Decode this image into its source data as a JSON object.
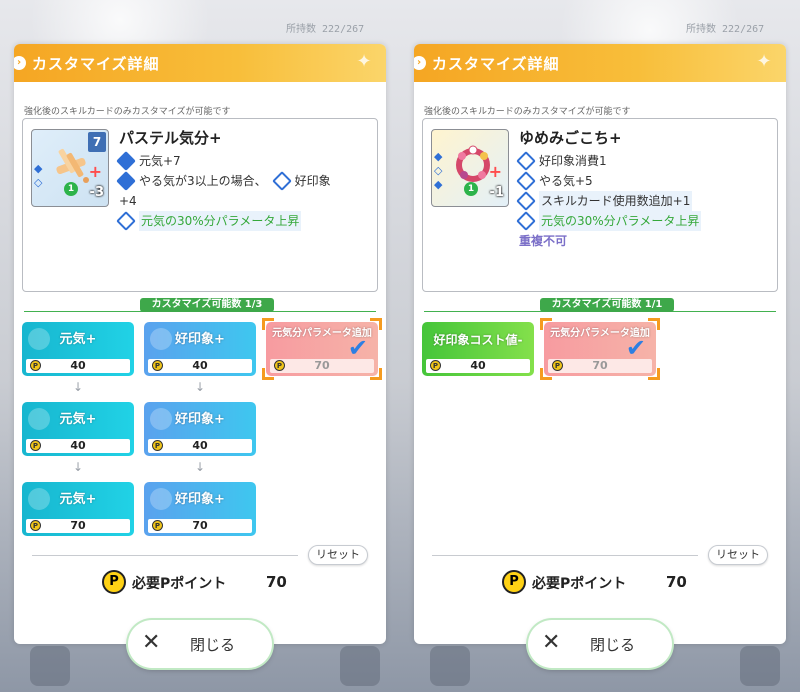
{
  "background": {
    "counter_left": "所持数 222/267",
    "counter_right": "所持数 222/267"
  },
  "panels": [
    {
      "title": "カスタマイズ詳細",
      "notice": "強化後のスキルカードのみカスタマイズが可能です",
      "card": {
        "name": "パステル気分+",
        "cost_badge": "7",
        "level": "1",
        "value_badge": "-3",
        "effects": [
          {
            "text": "元気+7",
            "style": "normal"
          },
          {
            "text": "やる気が3以上の場合、",
            "style": "normal",
            "extra": "好印象"
          },
          {
            "text": "+4",
            "style": "sub"
          },
          {
            "text": "元気の30%分パラメータ上昇",
            "style": "green"
          }
        ]
      },
      "customize_count": "カスタマイズ可能数 1/3",
      "tiles": [
        {
          "label": "元気+",
          "cost": "40"
        },
        {
          "label": "好印象+",
          "cost": "40"
        },
        {
          "label": "元気分パラメータ追加",
          "cost": "70"
        },
        {
          "label": "元気+",
          "cost": "40"
        },
        {
          "label": "好印象+",
          "cost": "40"
        },
        {
          "label": "元気+",
          "cost": "70"
        },
        {
          "label": "好印象+",
          "cost": "70"
        }
      ],
      "reset_label": "リセット",
      "need_label": "必要Pポイント",
      "need_value": "70",
      "close_label": "閉じる"
    },
    {
      "title": "カスタマイズ詳細",
      "notice": "強化後のスキルカードのみカスタマイズが可能です",
      "card": {
        "name": "ゆめみごこち+",
        "level": "1",
        "value_badge": "-1",
        "effects": [
          {
            "text": "好印象消費1",
            "style": "normal"
          },
          {
            "text": "やる気+5",
            "style": "normal"
          },
          {
            "text": "スキルカード使用数追加+1",
            "style": "normal"
          },
          {
            "text": "元気の30%分パラメータ上昇",
            "style": "green"
          },
          {
            "text": "重複不可",
            "style": "purple"
          }
        ]
      },
      "customize_count": "カスタマイズ可能数 1/1",
      "tiles": [
        {
          "label": "好印象コスト値-",
          "cost": "40"
        },
        {
          "label": "元気分パラメータ追加",
          "cost": "70"
        }
      ],
      "reset_label": "リセット",
      "need_label": "必要Pポイント",
      "need_value": "70",
      "close_label": "閉じる"
    }
  ],
  "icons": {
    "coin": "P",
    "check": "✔",
    "close": "✕",
    "arrow": "↓"
  }
}
